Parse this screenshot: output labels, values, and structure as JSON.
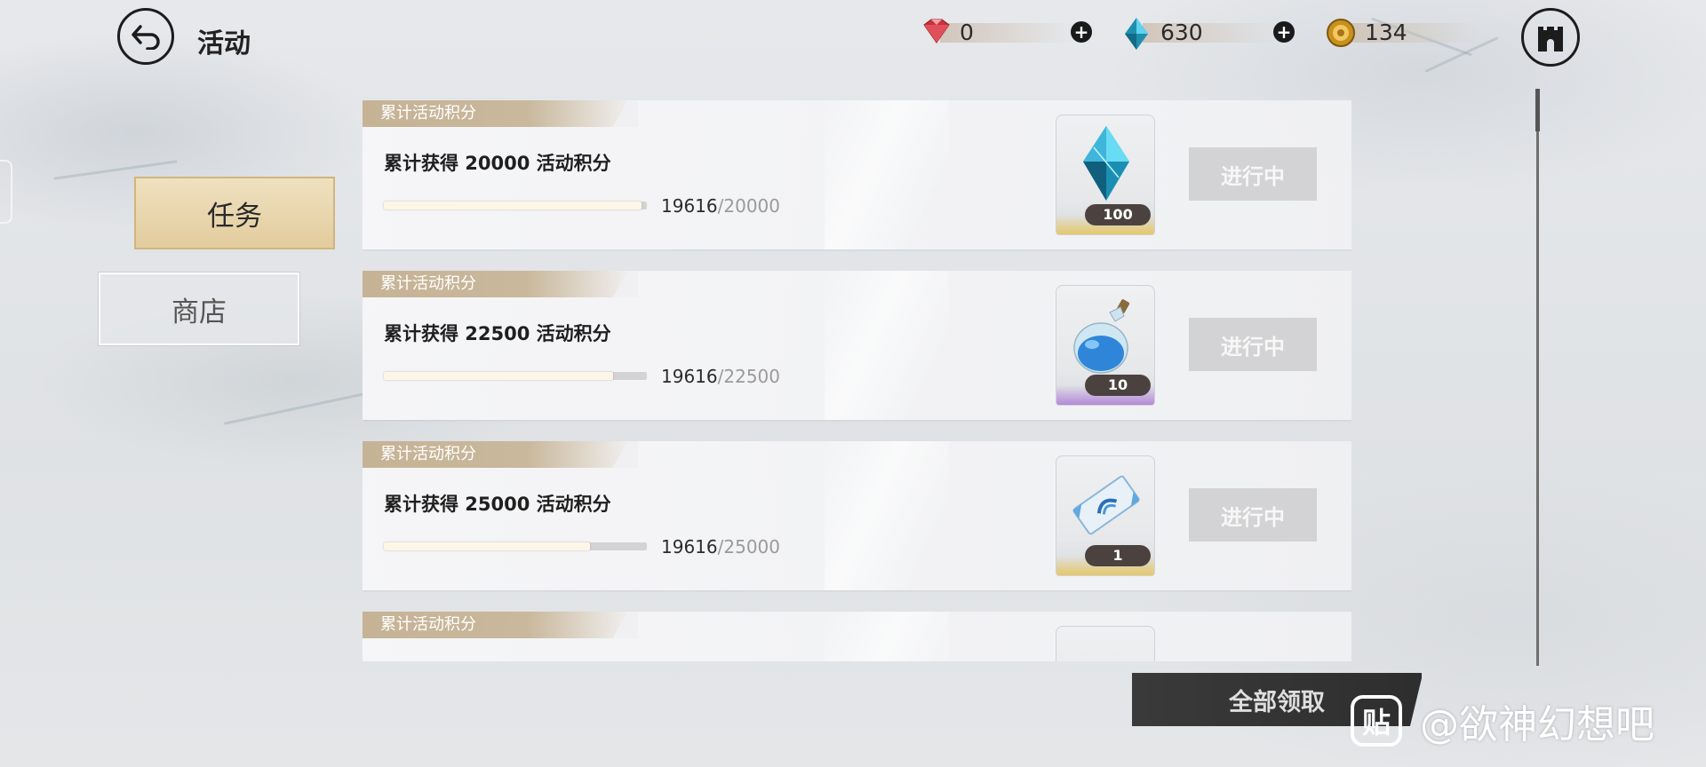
{
  "header": {
    "title": "活动",
    "currencies": [
      {
        "icon": "ruby-gem-icon",
        "value": "0",
        "color": "#c8323c"
      },
      {
        "icon": "blue-crystal-icon",
        "value": "630",
        "color": "#1f8fb0"
      },
      {
        "icon": "gold-coin-icon",
        "value": "134",
        "color": "#c8911e"
      }
    ]
  },
  "tabs": [
    {
      "label": "任务",
      "active": true
    },
    {
      "label": "商店",
      "active": false
    }
  ],
  "quests": [
    {
      "category": "累计活动积分",
      "title": "累计获得 20000 活动积分",
      "current": "19616",
      "total": "/20000",
      "progress": 0.9808,
      "reward_icon": "blue-crystal-icon",
      "reward_count": "100",
      "reward_rarity_color": "#e6c86a",
      "status": "进行中"
    },
    {
      "category": "累计活动积分",
      "title": "累计获得 22500 活动积分",
      "current": "19616",
      "total": "/22500",
      "progress": 0.8718,
      "reward_icon": "potion-bottle-icon",
      "reward_count": "10",
      "reward_rarity_color": "#b58ad8",
      "status": "进行中"
    },
    {
      "category": "累计活动积分",
      "title": "累计获得 25000 活动积分",
      "current": "19616",
      "total": "/25000",
      "progress": 0.7846,
      "reward_icon": "ticket-icon",
      "reward_count": "1",
      "reward_rarity_color": "#e6c86a",
      "status": "进行中"
    },
    {
      "category": "累计活动积分"
    }
  ],
  "footer": {
    "claim_all": "全部领取"
  },
  "watermark": {
    "logo_text": "贴",
    "text": "@欲神幻想吧"
  }
}
